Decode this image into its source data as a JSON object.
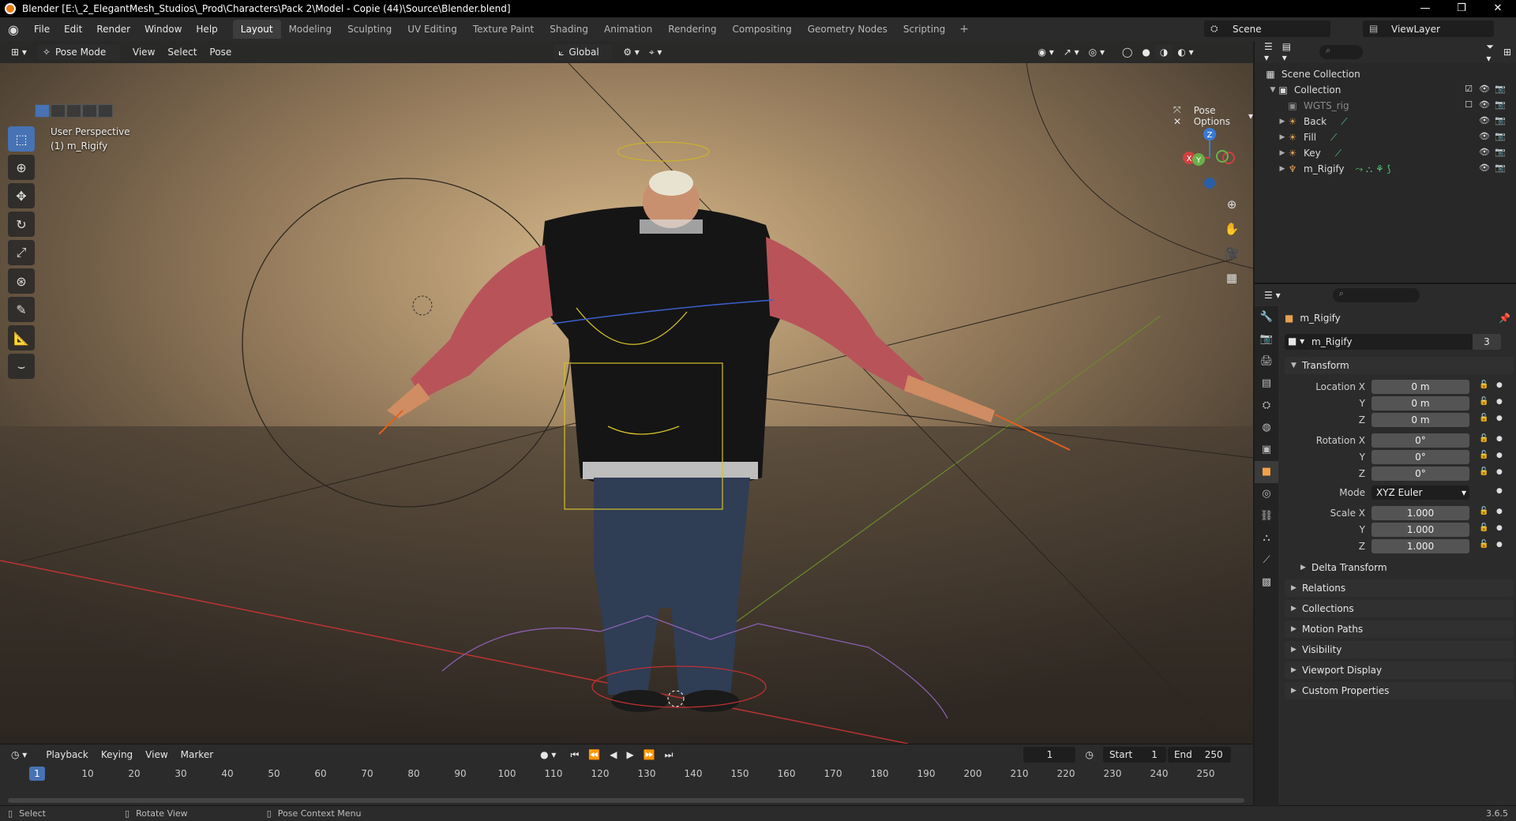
{
  "window": {
    "title": "Blender [E:\\_2_ElegantMesh_Studios\\_Prod\\Characters\\Pack 2\\Model - Copie (44)\\Source\\Blender.blend]",
    "controls": [
      "—",
      "❐",
      "✕"
    ]
  },
  "menubar": {
    "items": [
      "File",
      "Edit",
      "Render",
      "Window",
      "Help"
    ]
  },
  "workspaces": {
    "tabs": [
      "Layout",
      "Modeling",
      "Sculpting",
      "UV Editing",
      "Texture Paint",
      "Shading",
      "Animation",
      "Rendering",
      "Compositing",
      "Geometry Nodes",
      "Scripting"
    ],
    "active": "Layout",
    "add": "+"
  },
  "scene": {
    "name": "Scene"
  },
  "view_layer": {
    "name": "ViewLayer"
  },
  "viewport": {
    "mode": "Pose Mode",
    "menus": [
      "View",
      "Select",
      "Pose"
    ],
    "transform_orientation": "Global",
    "perspective_label": "User Perspective",
    "active_object_label": "(1) m_Rigify",
    "pose_options": "Pose Options",
    "gizmo": {
      "z": "Z",
      "y": "Y",
      "x": "X"
    }
  },
  "toolbar": {
    "tools": [
      "select-box",
      "cursor",
      "move",
      "rotate",
      "scale",
      "transform",
      "annotate",
      "measure",
      "bend"
    ]
  },
  "timeline": {
    "menus": [
      "Playback",
      "Keying",
      "View",
      "Marker"
    ],
    "current_frame": "1",
    "start_label": "Start",
    "start": "1",
    "end_label": "End",
    "end": "250",
    "ticks": [
      "10",
      "20",
      "30",
      "40",
      "50",
      "60",
      "70",
      "80",
      "90",
      "100",
      "110",
      "120",
      "130",
      "140",
      "150",
      "160",
      "170",
      "180",
      "190",
      "200",
      "210",
      "220",
      "230",
      "240",
      "250"
    ],
    "playhead": "1"
  },
  "statusbar": {
    "items": [
      "Select",
      "Rotate View",
      "Pose Context Menu"
    ],
    "version": "3.6.5"
  },
  "outliner": {
    "root": "Scene Collection",
    "collection": "Collection",
    "items": [
      {
        "name": "WGTS_rig",
        "dim": true
      },
      {
        "name": "Back",
        "dim": false
      },
      {
        "name": "Fill",
        "dim": false
      },
      {
        "name": "Key",
        "dim": false
      },
      {
        "name": "m_Rigify",
        "dim": false
      }
    ]
  },
  "properties": {
    "object_name_label": "m_Rigify",
    "object_name": "m_Rigify",
    "users": "3",
    "transform_header": "Transform",
    "location": {
      "label_x": "Location X",
      "label_y": "Y",
      "label_z": "Z",
      "x": "0 m",
      "y": "0 m",
      "z": "0 m"
    },
    "rotation": {
      "label_x": "Rotation X",
      "label_y": "Y",
      "label_z": "Z",
      "x": "0°",
      "y": "0°",
      "z": "0°"
    },
    "mode_label": "Mode",
    "mode": "XYZ Euler",
    "scale": {
      "label_x": "Scale X",
      "label_y": "Y",
      "label_z": "Z",
      "x": "1.000",
      "y": "1.000",
      "z": "1.000"
    },
    "delta_transform": "Delta Transform",
    "panels": [
      "Relations",
      "Collections",
      "Motion Paths",
      "Visibility",
      "Viewport Display",
      "Custom Properties"
    ]
  }
}
